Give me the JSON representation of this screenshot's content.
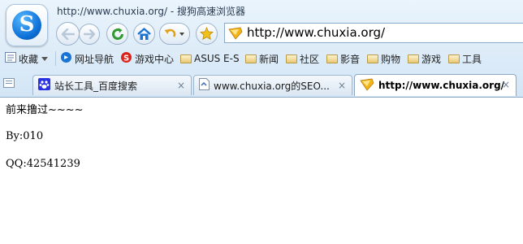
{
  "window": {
    "title": "http://www.chuxia.org/ - 搜狗高速浏览器",
    "logo_letter": "S"
  },
  "toolbar": {
    "address_url": "http://www.chuxia.org/",
    "buttons": [
      "back-icon",
      "forward-icon",
      "refresh-icon",
      "home-icon",
      "undo-icon",
      "star-icon"
    ]
  },
  "favorites": {
    "items": [
      {
        "label": "收藏",
        "icon": "favorites-icon"
      },
      {
        "label": "网址导航",
        "icon": "navigation-icon"
      },
      {
        "label": "游戏中心",
        "icon": "game-center-icon"
      },
      {
        "label": "ASUS E-S",
        "icon": "folder-icon"
      },
      {
        "label": "新闻",
        "icon": "folder-icon"
      },
      {
        "label": "社区",
        "icon": "folder-icon"
      },
      {
        "label": "影音",
        "icon": "folder-icon"
      },
      {
        "label": "购物",
        "icon": "folder-icon"
      },
      {
        "label": "游戏",
        "icon": "folder-icon"
      },
      {
        "label": "工具",
        "icon": "folder-icon"
      }
    ]
  },
  "tabs": [
    {
      "label": "站长工具_百度搜索",
      "close": "×",
      "active": false
    },
    {
      "label": "www.chuxia.org的SEO...",
      "close": "×",
      "active": false
    },
    {
      "label": "http://www.chuxia.org/",
      "close": "×",
      "active": true
    }
  ],
  "page": {
    "line1": "前来撸过~~~~",
    "line2": "By:010",
    "line3": "QQ:42541239"
  },
  "colors": {
    "chrome_bg": "#dcebf8",
    "accent_blue": "#1a74d6",
    "active_tab": "#ffffff"
  }
}
